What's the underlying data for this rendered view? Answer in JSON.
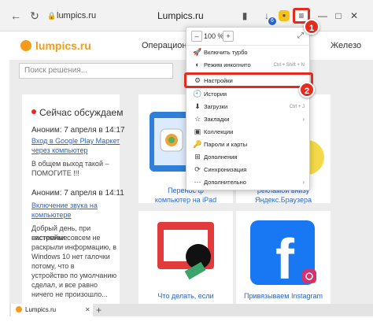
{
  "browser": {
    "address": "lumpics.ru",
    "page_title": "Lumpics.ru",
    "downloads_badge": "6",
    "tab_title": "Lumpics.ru"
  },
  "site": {
    "logo": "lumpics.ru",
    "nav": [
      "Операционные",
      "Железо"
    ],
    "search_placeholder": "Поиск решения...",
    "discuss_title": "Сейчас обсуждаем",
    "comments": [
      {
        "author": "Аноним: 7 апреля в 14:17",
        "link": [
          "Вход в Google Play Маркет",
          "через компьютер"
        ],
        "text": [
          "В общем выход такой –",
          "ПОМОГИТЕ !!!"
        ]
      },
      {
        "author": "Аноним: 7 апреля в 14:11",
        "link": [
          "Включение звука на",
          "компьютере"
        ],
        "text": [
          "Добрый день, при системные",
          "настройки совсем не",
          "раскрыли информацию, в",
          "Windows 10 нет галочки",
          "потому, что в",
          "устройство по умолчанию",
          "сделал, и все равно",
          "ничего не произошло..."
        ]
      }
    ],
    "articles": [
      {
        "caption": [
          "Перенос ф",
          "компьютер на iPad"
        ]
      },
      {
        "caption": [
          "",
          "рекламой внизу",
          "Яндекс.Браузера"
        ]
      },
      {
        "caption": [
          "Что делать, если",
          ""
        ]
      },
      {
        "caption": [
          "Привязываем Instagram",
          ""
        ]
      }
    ]
  },
  "menu": {
    "zoom": "100 %",
    "zoom_minus": "–",
    "zoom_plus": "+",
    "items": [
      {
        "label": "Включить турбо",
        "shortcut": "",
        "icon": "rocket-icon"
      },
      {
        "label": "Режим инкогнито",
        "shortcut": "Ctrl + Shift + N",
        "icon": "incognito-icon"
      },
      {
        "label": "Настройки",
        "shortcut": "",
        "icon": "gear-icon"
      },
      {
        "label": "История",
        "shortcut": "",
        "icon": "history-icon"
      },
      {
        "label": "Загрузки",
        "shortcut": "Ctrl + J",
        "icon": "download-icon"
      },
      {
        "label": "Закладки",
        "shortcut": "",
        "icon": "star-icon"
      },
      {
        "label": "Коллекции",
        "shortcut": "",
        "icon": "collections-icon"
      },
      {
        "label": "Пароли и карты",
        "shortcut": "",
        "icon": "key-icon"
      },
      {
        "label": "Дополнения",
        "shortcut": "",
        "icon": "puzzle-icon"
      },
      {
        "label": "Синхронизация",
        "shortcut": "",
        "icon": "sync-icon"
      },
      {
        "label": "Дополнительно",
        "shortcut": "",
        "icon": "more-icon"
      }
    ]
  },
  "callouts": [
    "1",
    "2"
  ],
  "colors": {
    "accent_red": "#e62b1e",
    "logo_orange": "#f49b1c",
    "link_blue": "#2a64c5"
  }
}
